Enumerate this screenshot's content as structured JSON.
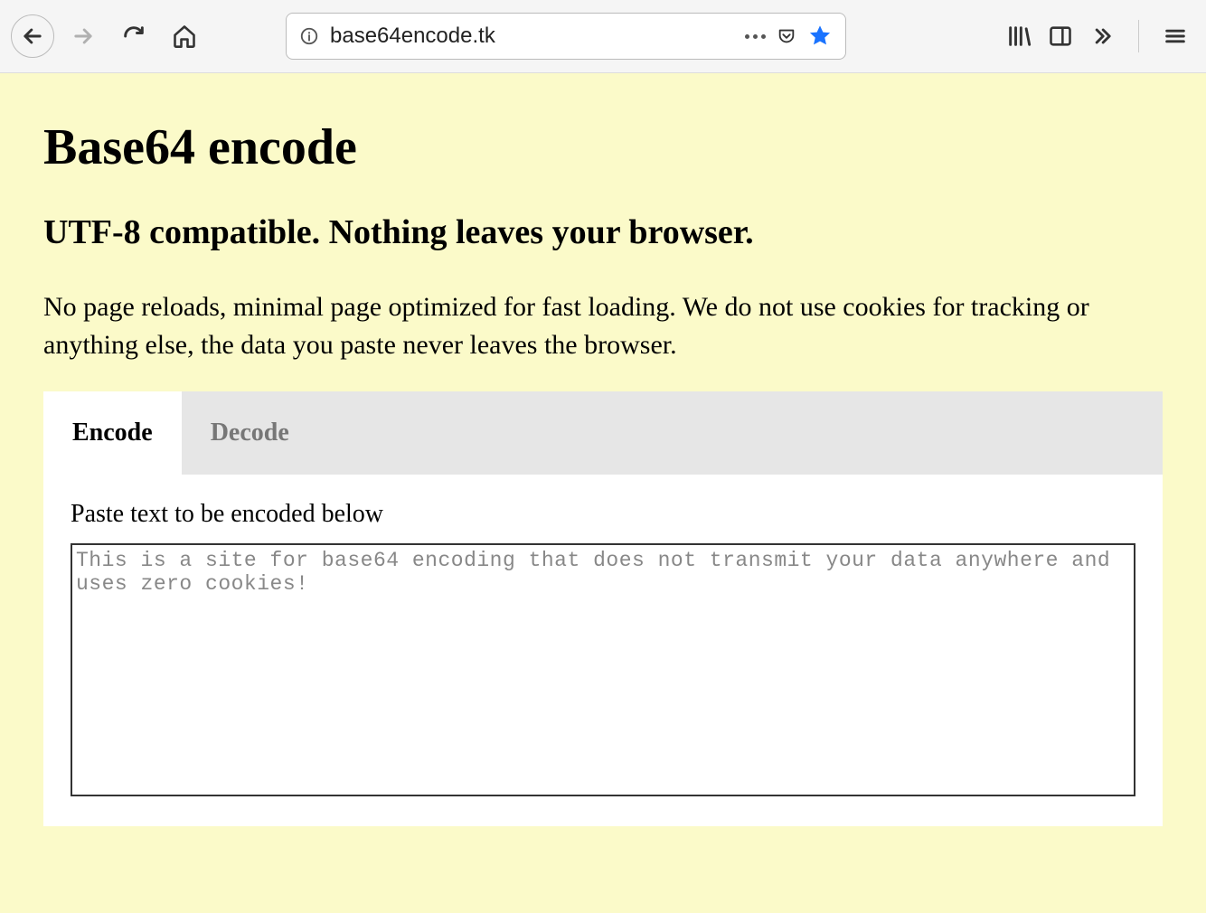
{
  "browser": {
    "url": "base64encode.tk"
  },
  "page": {
    "title": "Base64 encode",
    "subtitle": "UTF-8 compatible. Nothing leaves your browser.",
    "description": "No page reloads, minimal page optimized for fast loading. We do not use cookies for tracking or anything else, the data you paste never leaves the browser.",
    "tabs": {
      "encode": "Encode",
      "decode": "Decode"
    },
    "input_label": "Paste text to be encoded below",
    "input_value": "This is a site for base64 encoding that does not transmit your data anywhere and uses zero cookies!"
  }
}
